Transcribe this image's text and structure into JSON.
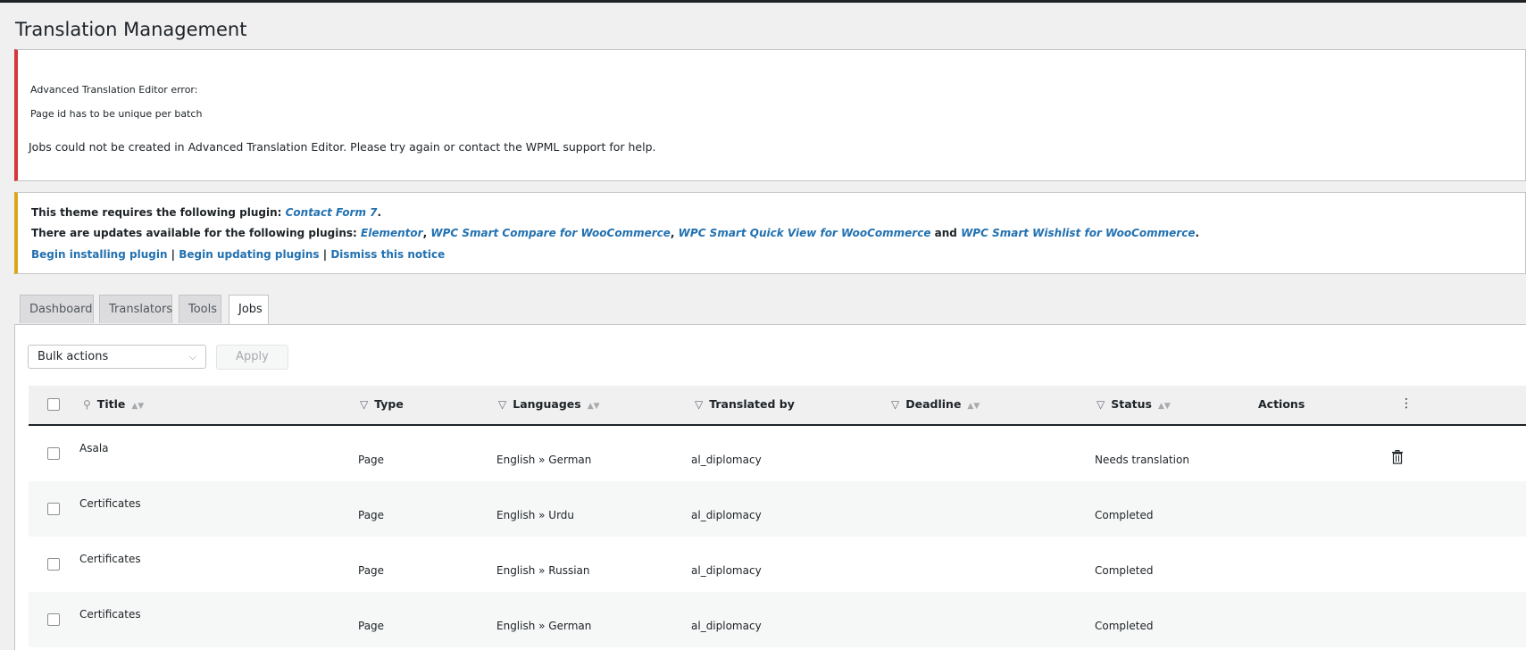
{
  "page": {
    "title": "Translation Management"
  },
  "error_notice": {
    "line1": "Advanced Translation Editor error:",
    "line2": "Page id has to be unique per batch",
    "line3": "Jobs could not be created in Advanced Translation Editor. Please try again or contact the WPML support for help."
  },
  "warning_notice": {
    "requires_prefix": "This theme requires the following plugin: ",
    "requires_plugin": "Contact Form 7",
    "requires_suffix": ".",
    "updates_prefix": "There are updates available for the following plugins: ",
    "plugin_1": "Elementor",
    "sep_1": ", ",
    "plugin_2": "WPC Smart Compare for WooCommerce",
    "sep_2": ", ",
    "plugin_3": "WPC Smart Quick View for WooCommerce",
    "and_text": " and ",
    "plugin_4": "WPC Smart Wishlist for WooCommerce",
    "updates_suffix": ".",
    "link_install": "Begin installing plugin",
    "link_update": "Begin updating plugins",
    "link_dismiss": "Dismiss this notice",
    "pipe": " | "
  },
  "tabs": [
    "Dashboard",
    "Translators",
    "Tools",
    "Jobs"
  ],
  "toolbar": {
    "bulk_actions": "Bulk actions",
    "apply": "Apply"
  },
  "table": {
    "columns": {
      "title": "Title",
      "type": "Type",
      "languages": "Languages",
      "translated_by": "Translated by",
      "deadline": "Deadline",
      "status": "Status",
      "actions": "Actions"
    },
    "rows": [
      {
        "title": "Asala",
        "type": "Page",
        "languages": "English » German",
        "translated_by": "al_diplomacy",
        "deadline": "",
        "status": "Needs translation"
      },
      {
        "title": "Certificates",
        "type": "Page",
        "languages": "English » Urdu",
        "translated_by": "al_diplomacy",
        "deadline": "",
        "status": "Completed"
      },
      {
        "title": "Certificates",
        "type": "Page",
        "languages": "English » Russian",
        "translated_by": "al_diplomacy",
        "deadline": "",
        "status": "Completed"
      },
      {
        "title": "Certificates",
        "type": "Page",
        "languages": "English » German",
        "translated_by": "al_diplomacy",
        "deadline": "",
        "status": "Completed"
      }
    ]
  },
  "icons": {
    "search": "search-icon",
    "filter": "filter-icon",
    "sort": "sort-icon",
    "trash": "trash-icon",
    "chevron": "chevron-down-icon",
    "kebab": "kebab-menu-icon"
  },
  "colors": {
    "error_border": "#d63638",
    "warning_border": "#dba617",
    "link": "#2271b1"
  }
}
